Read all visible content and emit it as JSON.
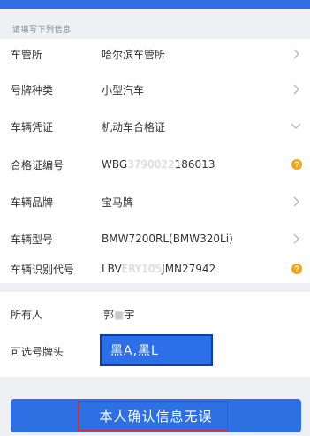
{
  "header": {
    "hint": "请填写下列信息"
  },
  "vehicle_form": {
    "fields": [
      {
        "label": "车管所",
        "value": "哈尔滨车管所"
      },
      {
        "label": "号牌种类",
        "value": "小型汽车"
      },
      {
        "label": "车辆凭证",
        "value": "机动车合格证"
      },
      {
        "label": "合格证编号",
        "value_prefix": "WBG",
        "value_hidden": "3790022",
        "value_suffix": "186013"
      },
      {
        "label": "车辆品牌",
        "value": "宝马牌"
      },
      {
        "label": "车辆型号",
        "value": "BMW7200RL(BMW320Li)"
      },
      {
        "label": "车辆识别代号",
        "value_prefix": "LBV",
        "value_hidden": "ERY105",
        "value_suffix": "JMN27942"
      }
    ]
  },
  "owner_form": {
    "owner_label": "所有人",
    "owner_value_first": "郭",
    "owner_value_hidden": "■",
    "owner_value_last": "宇",
    "plate_label": "可选号牌头",
    "plate_value": "黑A,黑L"
  },
  "actions": {
    "confirm_label": "本人确认信息无误"
  },
  "icons": {
    "chevron_right": "chevron-right-icon",
    "chevron_down": "chevron-down-icon",
    "info": "info-icon"
  },
  "colors": {
    "primary": "#2f6fe4",
    "warning": "#f2a51b",
    "highlight_outline": "#d72a2a",
    "background": "#eef0f4"
  }
}
